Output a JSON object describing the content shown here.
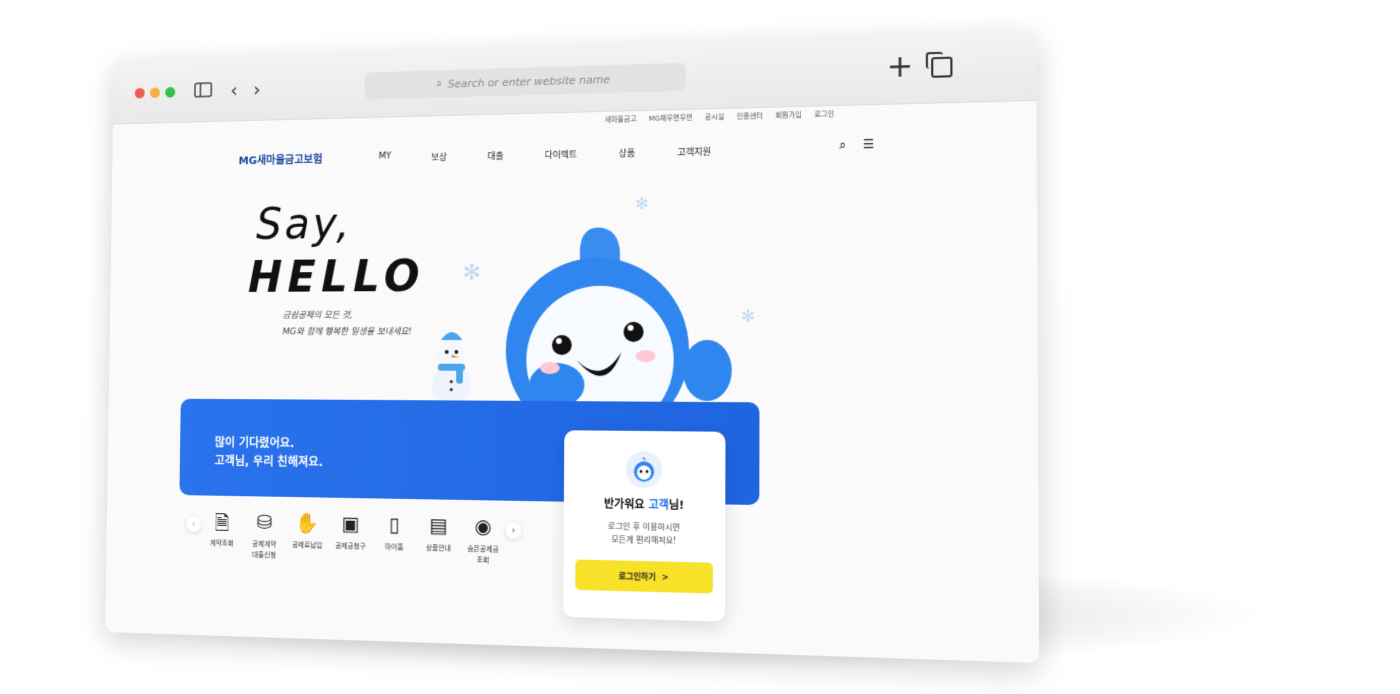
{
  "browser": {
    "address_placeholder": "Search or enter website name",
    "back_icon": "chevron-left-icon",
    "forward_icon": "chevron-right-icon"
  },
  "utility_links": [
    "새마을금고",
    "MG채우면우편",
    "공시실",
    "인증센터",
    "회원가입",
    "로그인"
  ],
  "header": {
    "logo": "MG새마을금고보험",
    "menu": [
      "MY",
      "보상",
      "대출",
      "다이렉트",
      "상품",
      "고객지원"
    ]
  },
  "hero": {
    "say": "Say,",
    "hello": "HELLO",
    "line1": "금쉼공제의 모든 것,",
    "line2": "MG와 함께 행복한 일생을 보내세요!"
  },
  "banner": {
    "line1": "많이 기다렸어요.",
    "line2": "고객님, 우리 친해져요."
  },
  "login_card": {
    "greeting": "반가워요",
    "name": "고객",
    "suffix": "님!",
    "sub1": "로그인 후 이용하시면",
    "sub2": "모든게 편리해져요!",
    "button": "로그인하기",
    "button_arrow": ">"
  },
  "quick_menu": [
    {
      "label": "계약조회",
      "icon": "document-search-icon"
    },
    {
      "label": "공제계약\n대출신청",
      "icon": "coins-icon"
    },
    {
      "label": "공제료납입",
      "icon": "payment-icon"
    },
    {
      "label": "공제금청구",
      "icon": "claim-icon"
    },
    {
      "label": "마이홈",
      "icon": "phone-icon"
    },
    {
      "label": "상품안내",
      "icon": "book-icon"
    },
    {
      "label": "숨은공제금\n조회",
      "icon": "monitor-eye-icon"
    }
  ],
  "colors": {
    "accent": "#1f64e0",
    "login_button": "#f7e129",
    "logo": "#1b4ba0"
  }
}
